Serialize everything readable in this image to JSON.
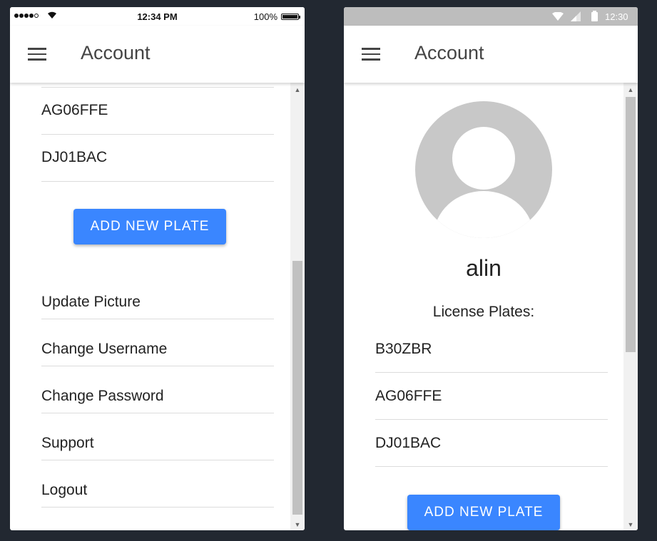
{
  "ios": {
    "status": {
      "time": "12:34 PM",
      "battery": "100%"
    },
    "appbar": {
      "title": "Account"
    },
    "plates": [
      "AG06FFE",
      "DJ01BAC"
    ],
    "add_button": "ADD NEW PLATE",
    "menu": [
      {
        "label": "Update Picture"
      },
      {
        "label": "Change Username"
      },
      {
        "label": "Change Password"
      },
      {
        "label": "Support"
      },
      {
        "label": "Logout"
      }
    ],
    "scroll_position": 0.9
  },
  "android": {
    "status": {
      "time": "12:30"
    },
    "appbar": {
      "title": "Account"
    },
    "username": "alin",
    "plates_label": "License Plates:",
    "plates": [
      "B30ZBR",
      "AG06FFE",
      "DJ01BAC"
    ],
    "add_button": "ADD NEW PLATE",
    "scroll_position": 0.0
  },
  "colors": {
    "accent": "#3a86ff",
    "background": "#222831",
    "avatar": "#c8c8c8"
  },
  "icons": [
    "menu-icon",
    "wifi-icon",
    "signal-icon",
    "battery-icon",
    "avatar-placeholder-icon",
    "chevron-up-icon",
    "chevron-down-icon"
  ]
}
